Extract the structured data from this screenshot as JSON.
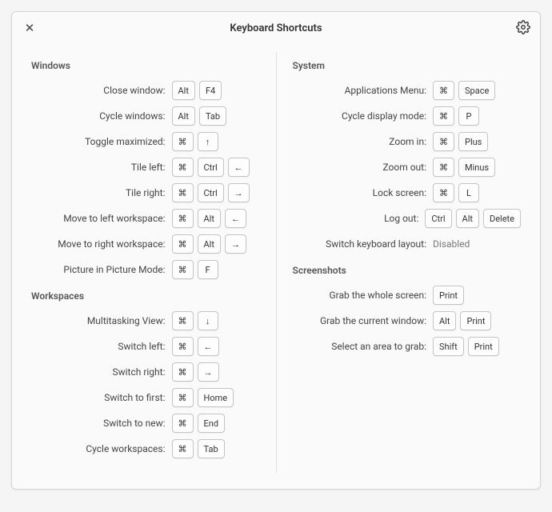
{
  "title": "Keyboard Shortcuts",
  "sections": {
    "windows": {
      "title": "Windows",
      "rows": [
        {
          "label": "Close window:",
          "keys": [
            "Alt",
            "F4"
          ]
        },
        {
          "label": "Cycle windows:",
          "keys": [
            "Alt",
            "Tab"
          ]
        },
        {
          "label": "Toggle maximized:",
          "keys": [
            "⌘",
            "↑"
          ]
        },
        {
          "label": "Tile left:",
          "keys": [
            "⌘",
            "Ctrl",
            "←"
          ]
        },
        {
          "label": "Tile right:",
          "keys": [
            "⌘",
            "Ctrl",
            "→"
          ]
        },
        {
          "label": "Move to left workspace:",
          "keys": [
            "⌘",
            "Alt",
            "←"
          ]
        },
        {
          "label": "Move to right workspace:",
          "keys": [
            "⌘",
            "Alt",
            "→"
          ]
        },
        {
          "label": "Picture in Picture Mode:",
          "keys": [
            "⌘",
            "F"
          ]
        }
      ]
    },
    "workspaces": {
      "title": "Workspaces",
      "rows": [
        {
          "label": "Multitasking View:",
          "keys": [
            "⌘",
            "↓"
          ]
        },
        {
          "label": "Switch left:",
          "keys": [
            "⌘",
            "←"
          ]
        },
        {
          "label": "Switch right:",
          "keys": [
            "⌘",
            "→"
          ]
        },
        {
          "label": "Switch to first:",
          "keys": [
            "⌘",
            "Home"
          ]
        },
        {
          "label": "Switch to new:",
          "keys": [
            "⌘",
            "End"
          ]
        },
        {
          "label": "Cycle workspaces:",
          "keys": [
            "⌘",
            "Tab"
          ]
        }
      ]
    },
    "system": {
      "title": "System",
      "rows": [
        {
          "label": "Applications Menu:",
          "keys": [
            "⌘",
            "Space"
          ]
        },
        {
          "label": "Cycle display mode:",
          "keys": [
            "⌘",
            "P"
          ]
        },
        {
          "label": "Zoom in:",
          "keys": [
            "⌘",
            "Plus"
          ]
        },
        {
          "label": "Zoom out:",
          "keys": [
            "⌘",
            "Minus"
          ]
        },
        {
          "label": "Lock screen:",
          "keys": [
            "⌘",
            "L"
          ]
        },
        {
          "label": "Log out:",
          "keys": [
            "Ctrl",
            "Alt",
            "Delete"
          ]
        },
        {
          "label": "Switch keyboard layout:",
          "disabled": "Disabled"
        }
      ]
    },
    "screenshots": {
      "title": "Screenshots",
      "rows": [
        {
          "label": "Grab the whole screen:",
          "keys": [
            "Print"
          ]
        },
        {
          "label": "Grab the current window:",
          "keys": [
            "Alt",
            "Print"
          ]
        },
        {
          "label": "Select an area to grab:",
          "keys": [
            "Shift",
            "Print"
          ]
        }
      ]
    }
  }
}
